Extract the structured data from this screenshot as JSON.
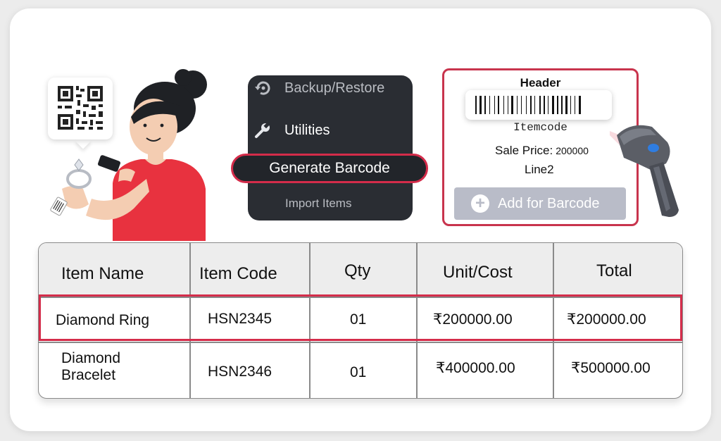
{
  "menu": {
    "items": [
      {
        "label": "Backup/Restore",
        "icon": "backup-restore-icon"
      },
      {
        "label": "Utilities",
        "icon": "wrench-icon"
      },
      {
        "label": "Generate Barcode",
        "selected": true
      },
      {
        "label": "Import Items"
      }
    ]
  },
  "label_preview": {
    "header": "Header",
    "item_code": "Itemcode",
    "sale_price_label": "Sale Price:",
    "sale_price_value": "200000",
    "line2": "Line2",
    "add_button": "Add for Barcode"
  },
  "table": {
    "columns": [
      "Item Name",
      "Item Code",
      "Qty",
      "Unit/Cost",
      "Total"
    ],
    "rows": [
      {
        "name": "Diamond Ring",
        "code": "HSN2345",
        "qty": "01",
        "unit_cost": "₹200000.00",
        "total": "₹200000.00",
        "highlighted": true
      },
      {
        "name_line1": "Diamond",
        "name_line2": "Bracelet",
        "code": "HSN2346",
        "qty": "01",
        "unit_cost": "₹400000.00",
        "total": "₹500000.00"
      }
    ]
  },
  "colors": {
    "accent": "#d42c4a",
    "menu_bg": "#2a2d33",
    "button_disabled": "#b9bcc8",
    "shirt": "#e8323f"
  }
}
